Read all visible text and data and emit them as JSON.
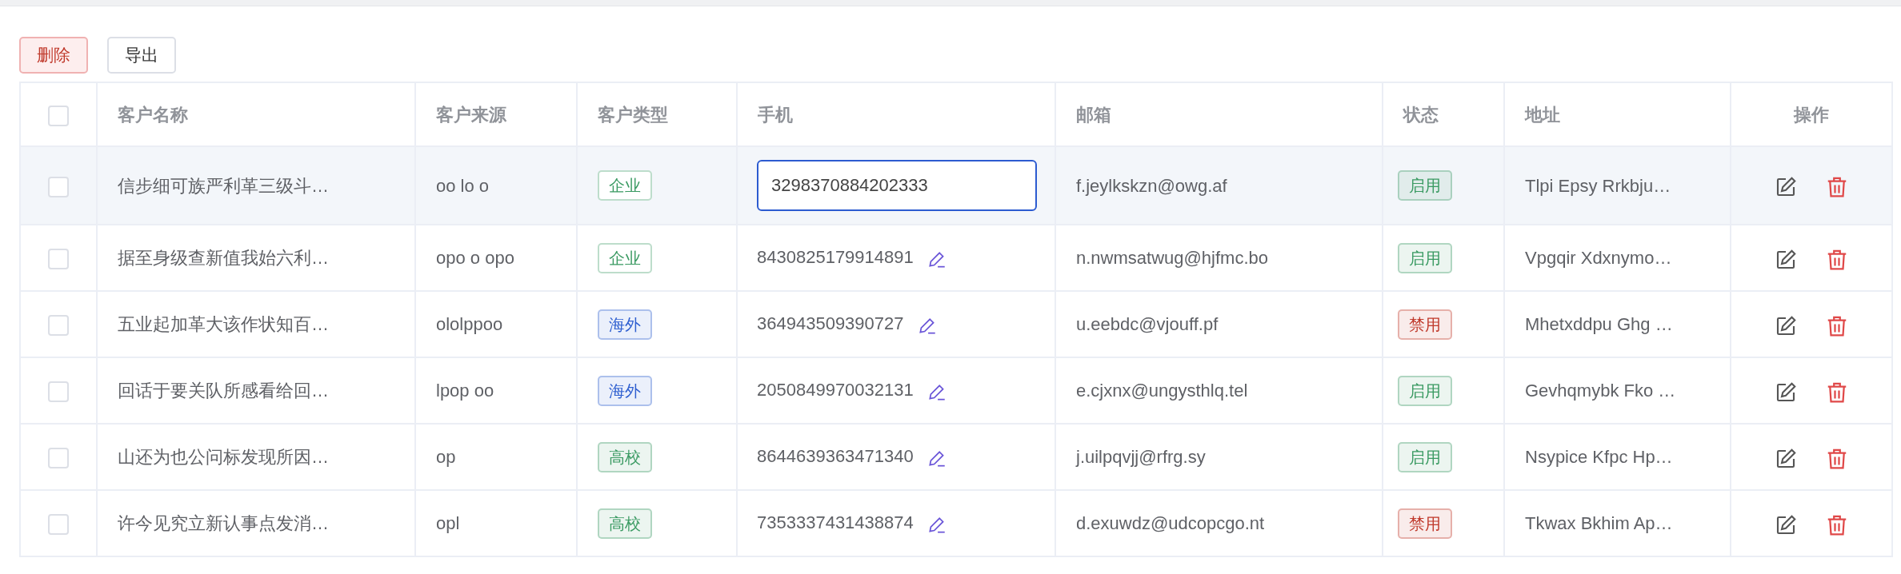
{
  "toolbar": [
    {
      "label": "删除",
      "kind": "danger"
    },
    {
      "label": "导出",
      "kind": "plain"
    }
  ],
  "table": {
    "select_all": {
      "checked": false
    },
    "columns": [
      "客户名称",
      "客户来源",
      "客户类型",
      "手机",
      "邮箱",
      "状态",
      "地址",
      "操作"
    ],
    "rows": [
      {
        "checked": false,
        "highlighted": true,
        "name": "信步细可族严利革三级斗…",
        "source": "oo lo o",
        "type": {
          "text": "企业",
          "kind": "outline",
          "color": "#3a9a62"
        },
        "phone": "3298370884202333",
        "editing": true,
        "email": "f.jeylkskzn@owg.af",
        "status": {
          "text": "启用",
          "color": "#3a9a62"
        },
        "address": "Tlpi Epsy Rrkbju…"
      },
      {
        "checked": false,
        "highlighted": false,
        "name": "据至身级查新值我始六利…",
        "source": "opo o opo",
        "type": {
          "text": "企业",
          "kind": "outline",
          "color": "#3a9a62"
        },
        "phone": "8430825179914891",
        "editing": false,
        "email": "n.nwmsatwug@hjfmc.bo",
        "status": {
          "text": "启用",
          "color": "#3a9a62"
        },
        "address": "Vpgqir Xdxnymo…"
      },
      {
        "checked": false,
        "highlighted": false,
        "name": "五业起加革大该作状知百…",
        "source": "ololppoo",
        "type": {
          "text": "海外",
          "kind": "light",
          "color": "#2f5fd0"
        },
        "phone": "364943509390727",
        "editing": false,
        "email": "u.eebdc@vjouff.pf",
        "status": {
          "text": "禁用",
          "color": "#c0392b"
        },
        "address": "Mhetxddpu Ghg …"
      },
      {
        "checked": false,
        "highlighted": false,
        "name": "回话于要关队所感看给回…",
        "source": "lpop oo",
        "type": {
          "text": "海外",
          "kind": "light",
          "color": "#2f5fd0"
        },
        "phone": "2050849970032131",
        "editing": false,
        "email": "e.cjxnx@ungysthlq.tel",
        "status": {
          "text": "启用",
          "color": "#3a9a62"
        },
        "address": "Gevhqmybk Fko …"
      },
      {
        "checked": false,
        "highlighted": false,
        "name": "山还为也公问标发现所因…",
        "source": "op",
        "type": {
          "text": "高校",
          "kind": "light",
          "color": "#3a9a62"
        },
        "phone": "8644639363471340",
        "editing": false,
        "email": "j.uilpqvjj@rfrg.sy",
        "status": {
          "text": "启用",
          "color": "#3a9a62"
        },
        "address": "Nsypice Kfpc Hp…"
      },
      {
        "checked": false,
        "highlighted": false,
        "name": "许今见究立新认事点发消…",
        "source": "opl",
        "type": {
          "text": "高校",
          "kind": "light",
          "color": "#3a9a62"
        },
        "phone": "7353337431438874",
        "editing": false,
        "email": "d.exuwdz@udcopcgo.nt",
        "status": {
          "text": "禁用",
          "color": "#c0392b"
        },
        "address": "Tkwax Bkhim Ap…"
      }
    ]
  }
}
